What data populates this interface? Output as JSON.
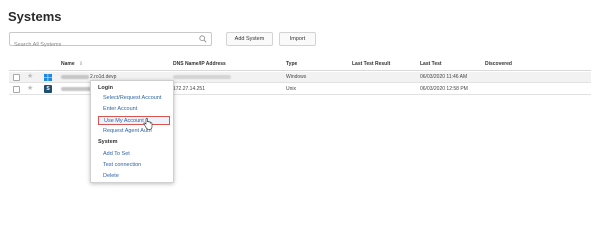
{
  "page": {
    "title": "Systems"
  },
  "search": {
    "placeholder": "Search All Systems"
  },
  "buttons": {
    "add_system": "Add System",
    "import": "Import"
  },
  "table": {
    "columns": {
      "name": "Name",
      "dns": "DNS Name/IP Address",
      "type": "Type",
      "last_test_result": "Last Test Result",
      "last_test": "Last Test",
      "discovered": "Discovered"
    },
    "rows": [
      {
        "name_suffix": "2.ro1d.devp",
        "dns": "",
        "type": "Windows",
        "last_test_result": "",
        "last_test": "06/03/2020 11:46 AM",
        "discovered": "",
        "os_icon": "windows-icon"
      },
      {
        "name_suffix": "",
        "dns": "172.27.14.251",
        "type": "Unix",
        "last_test_result": "",
        "last_test": "06/03/2020 12:58 PM",
        "discovered": "",
        "os_icon": "s-app-icon"
      }
    ]
  },
  "context_menu": {
    "login_header": "Login",
    "login_items": [
      "Select/Request Account",
      "Enter Account",
      "Use My Account",
      "Request Agent Auth"
    ],
    "system_header": "System",
    "system_items": [
      "Add To Set",
      "Test connection",
      "Delete"
    ]
  },
  "colors": {
    "link": "#2d64a8",
    "highlight_border": "#d9534f",
    "windows_blue": "#1e88e5"
  }
}
